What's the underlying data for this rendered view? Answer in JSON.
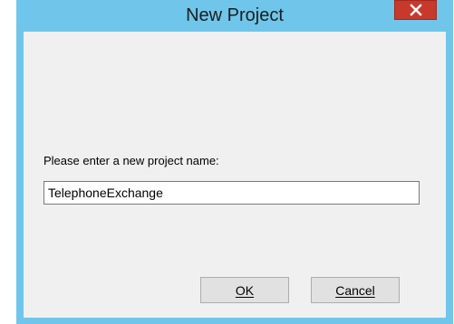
{
  "dialog": {
    "title": "New Project",
    "prompt": "Please enter a new project name:",
    "input_value": "TelephoneExchange",
    "ok_label": "OK",
    "cancel_label": "Cancel",
    "close_icon": "close-icon",
    "frame_color": "#6fc6ea",
    "close_color": "#c7392b"
  }
}
